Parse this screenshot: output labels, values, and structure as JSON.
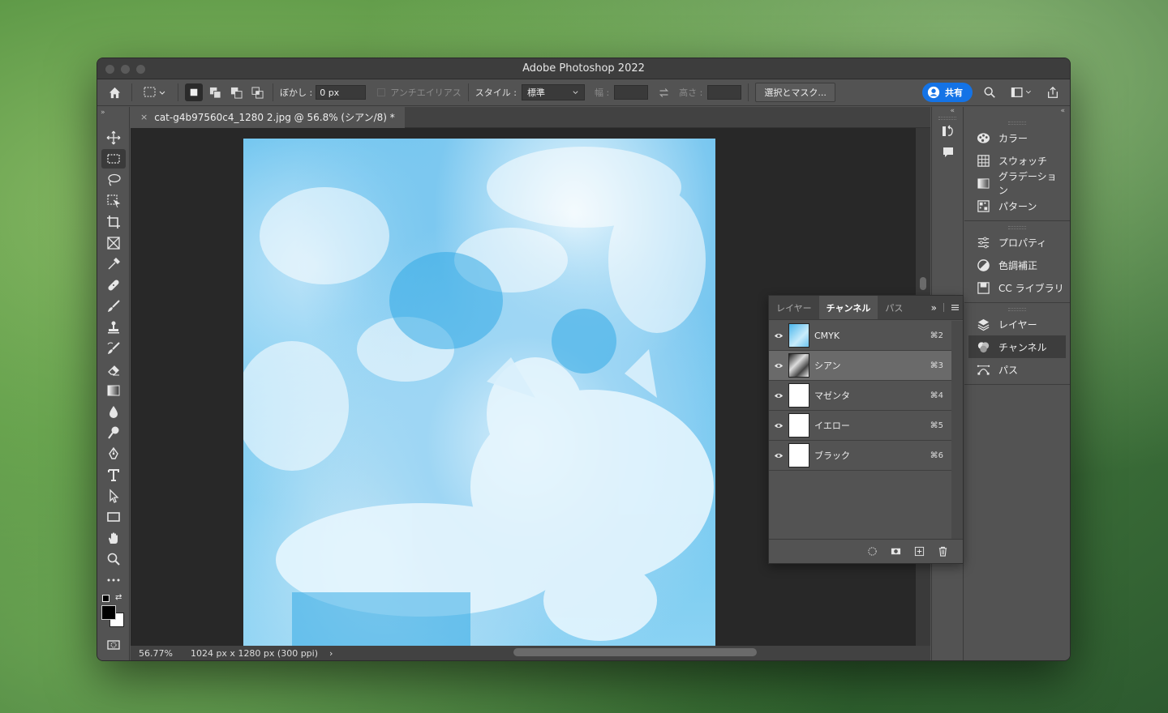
{
  "window": {
    "title": "Adobe Photoshop 2022"
  },
  "options": {
    "feather_label": "ぼかし :",
    "feather_value": "0 px",
    "antialias_label": "アンチエイリアス",
    "style_label": "スタイル :",
    "style_value": "標準",
    "width_label": "幅 :",
    "height_label": "高さ :",
    "select_mask_label": "選択とマスク...",
    "share_label": "共有"
  },
  "document": {
    "tab_title": "cat-g4b97560c4_1280 2.jpg @ 56.8% (シアン/8) *",
    "close_glyph": "×",
    "zoom": "56.77%",
    "dimensions": "1024 px x 1280 px (300 ppi)",
    "status_arrow": "›"
  },
  "right_panel": {
    "group1": [
      {
        "label": "カラー",
        "icon": "palette-icon"
      },
      {
        "label": "スウォッチ",
        "icon": "swatches-icon"
      },
      {
        "label": "グラデーション",
        "icon": "gradient-icon"
      },
      {
        "label": "パターン",
        "icon": "pattern-icon"
      }
    ],
    "group2": [
      {
        "label": "プロパティ",
        "icon": "properties-icon"
      },
      {
        "label": "色調補正",
        "icon": "adjustments-icon"
      },
      {
        "label": "CC ライブラリ",
        "icon": "libraries-icon"
      }
    ],
    "group3": [
      {
        "label": "レイヤー",
        "icon": "layers-icon"
      },
      {
        "label": "チャンネル",
        "icon": "channels-icon"
      },
      {
        "label": "パス",
        "icon": "paths-icon"
      }
    ]
  },
  "channels_panel": {
    "tabs": [
      "レイヤー",
      "チャンネル",
      "パス"
    ],
    "active_tab": "チャンネル",
    "channels": [
      {
        "name": "CMYK",
        "shortcut": "⌘2"
      },
      {
        "name": "シアン",
        "shortcut": "⌘3"
      },
      {
        "name": "マゼンタ",
        "shortcut": "⌘4"
      },
      {
        "name": "イエロー",
        "shortcut": "⌘5"
      },
      {
        "name": "ブラック",
        "shortcut": "⌘6"
      }
    ]
  }
}
